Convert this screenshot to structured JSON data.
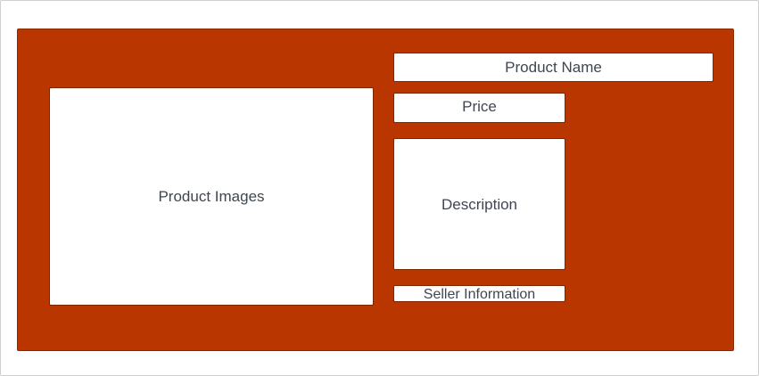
{
  "colors": {
    "background": "#ffffff",
    "panel_fill": "#b93600",
    "box_fill": "#ffffff",
    "text": "#3f4652"
  },
  "layout": {
    "product_images": "Product Images",
    "product_name": "Product Name",
    "price": "Price",
    "description": "Description",
    "seller_information": "Seller Information"
  }
}
